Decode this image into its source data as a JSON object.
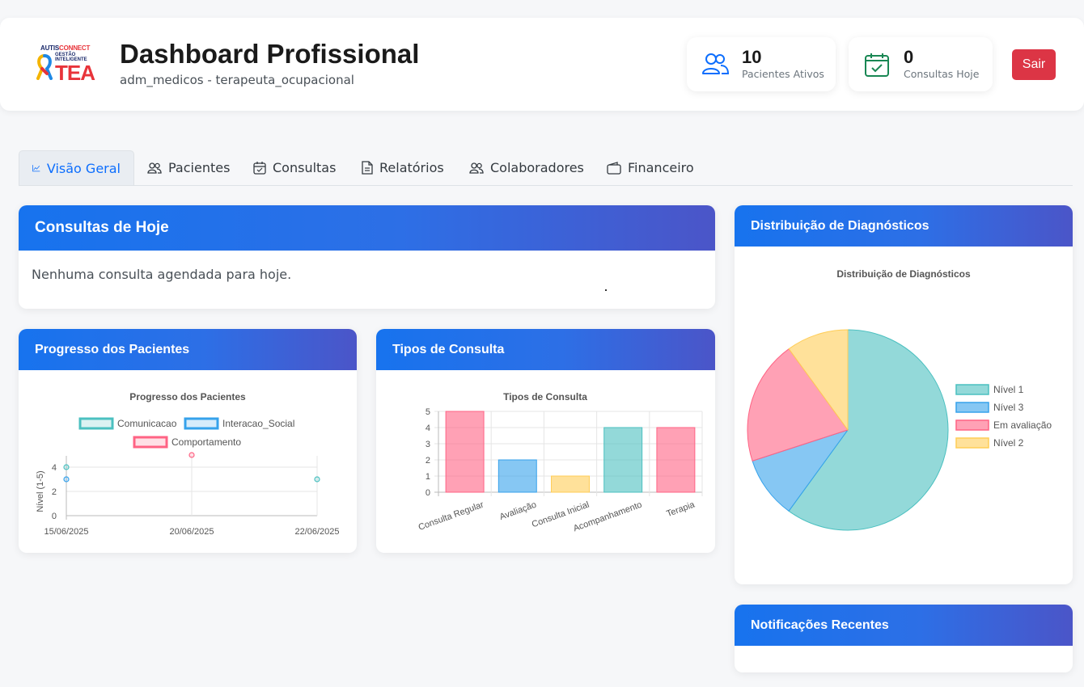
{
  "header": {
    "logo": {
      "line1a": "AUTIS",
      "line1b": "CONNECT",
      "line2": "GESTÃO",
      "line3": "INTELIGENTE",
      "mark": "TEA"
    },
    "title": "Dashboard Profissional",
    "subtitle": "adm_medicos - terapeuta_ocupacional",
    "stats": [
      {
        "icon": "users-icon",
        "value": "10",
        "label": "Pacientes Ativos"
      },
      {
        "icon": "calendar-check-icon",
        "value": "0",
        "label": "Consultas Hoje"
      }
    ],
    "logout_label": "Sair"
  },
  "tabs": [
    {
      "label": "Visão Geral",
      "icon": "chart-line-icon",
      "active": true
    },
    {
      "label": "Pacientes",
      "icon": "users-icon"
    },
    {
      "label": "Consultas",
      "icon": "calendar-icon"
    },
    {
      "label": "Relatórios",
      "icon": "document-icon"
    },
    {
      "label": "Colaboradores",
      "icon": "users-icon"
    },
    {
      "label": "Financeiro",
      "icon": "wallet-icon"
    }
  ],
  "today": {
    "title": "Consultas de Hoje",
    "empty": "Nenhuma consulta agendada para hoje."
  },
  "progress": {
    "title": "Progresso dos Pacientes"
  },
  "types": {
    "title": "Tipos de Consulta"
  },
  "diagnosis": {
    "title": "Distribuição de Diagnósticos"
  },
  "notifications": {
    "title": "Notificações Recentes"
  },
  "colors": {
    "primary": "#0d6efd",
    "danger": "#dc3545",
    "teal": "#4bc0c0",
    "blue": "#36a2eb",
    "pink": "#ff6384",
    "yellow": "#ffcd56"
  },
  "chart_data": [
    {
      "type": "scatter",
      "title": "Progresso dos Pacientes",
      "xlabel": "",
      "ylabel": "Nível (1-5)",
      "x": [
        "15/06/2025",
        "20/06/2025",
        "22/06/2025"
      ],
      "ylim": [
        0,
        4
      ],
      "yticks": [
        0,
        2,
        4
      ],
      "legend_position": "top",
      "series": [
        {
          "name": "Comunicacao",
          "color": "#4bc0c0",
          "points": [
            [
              "15/06/2025",
              4
            ],
            [
              "22/06/2025",
              3
            ]
          ]
        },
        {
          "name": "Interacao_Social",
          "color": "#36a2eb",
          "points": [
            [
              "15/06/2025",
              3
            ]
          ]
        },
        {
          "name": "Comportamento",
          "color": "#ff6384",
          "points": [
            [
              "20/06/2025",
              5
            ]
          ]
        }
      ]
    },
    {
      "type": "bar",
      "title": "Tipos de Consulta",
      "categories": [
        "Consulta Regular",
        "Avaliação",
        "Consulta Inicial",
        "Acompanhamento",
        "Terapia"
      ],
      "values": [
        5,
        2,
        1,
        4,
        4
      ],
      "colors": [
        "#ff6384",
        "#36a2eb",
        "#ffcd56",
        "#4bc0c0",
        "#ff6384"
      ],
      "ylim": [
        0,
        5
      ],
      "yticks": [
        0,
        1,
        2,
        3,
        4,
        5
      ]
    },
    {
      "type": "pie",
      "title": "Distribuição de Diagnósticos",
      "legend_position": "right",
      "labels": [
        "Nível 1",
        "Nível 3",
        "Em avaliação",
        "Nível 2"
      ],
      "values": [
        6,
        1,
        2,
        1
      ],
      "colors": [
        "#4bc0c0",
        "#36a2eb",
        "#ff6384",
        "#ffcd56"
      ]
    }
  ]
}
